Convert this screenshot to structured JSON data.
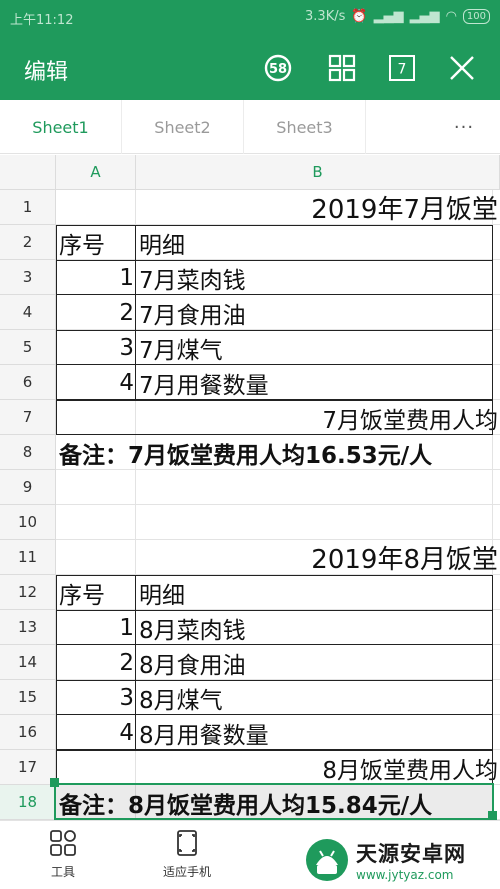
{
  "status": {
    "time": "上午11:12",
    "speed": "3.3K/s",
    "battery": "100"
  },
  "appbar": {
    "title": "编辑",
    "badge_count": "58",
    "page_count": "7"
  },
  "tabs": [
    "Sheet1",
    "Sheet2",
    "Sheet3"
  ],
  "tabs_more": "···",
  "columns": [
    "A",
    "B"
  ],
  "rows": [
    "1",
    "2",
    "3",
    "4",
    "5",
    "6",
    "7",
    "8",
    "9",
    "10",
    "11",
    "12",
    "13",
    "14",
    "15",
    "16",
    "17",
    "18"
  ],
  "sheet": {
    "r1_title": "2019年7月饭堂",
    "r2_a": "序号",
    "r2_b": "明细",
    "r3_a": "1",
    "r3_b": "7月菜肉钱",
    "r4_a": "2",
    "r4_b": "7月食用油",
    "r5_a": "3",
    "r5_b": "7月煤气",
    "r6_a": "4",
    "r6_b": "7月用餐数量",
    "r7_b": "7月饭堂费用人均",
    "r8_note": "备注：7月饭堂费用人均16.53元/人",
    "r11_title": "2019年8月饭堂",
    "r12_a": "序号",
    "r12_b": "明细",
    "r13_a": "1",
    "r13_b": "8月菜肉钱",
    "r14_a": "2",
    "r14_b": "8月食用油",
    "r15_a": "3",
    "r15_b": "8月煤气",
    "r16_a": "4",
    "r16_b": "8月用餐数量",
    "r17_b": "8月饭堂费用人均",
    "r18_note": "备注：8月饭堂费用人均15.84元/人"
  },
  "toolbar": {
    "tools_label": "工具",
    "fit_label": "适应手机"
  },
  "watermark": {
    "name": "天源安卓网",
    "url": "www.jytyaz.com"
  },
  "colors": {
    "brand": "#1f9a5c"
  }
}
